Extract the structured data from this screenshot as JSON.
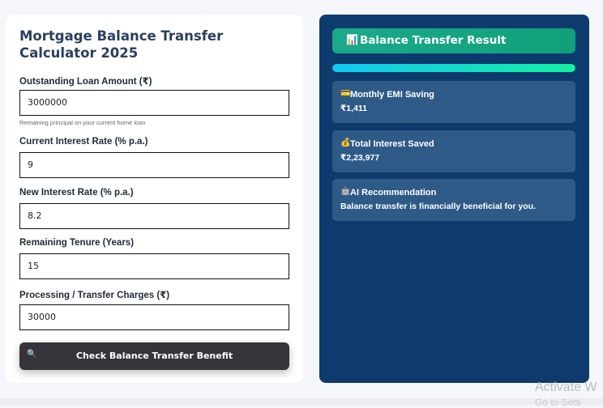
{
  "calculator": {
    "title": "Mortgage Balance Transfer Calculator 2025",
    "fields": [
      {
        "label": "Outstanding Loan Amount (₹)",
        "value": "3000000",
        "hint": "Remaining principal on your current home loan"
      },
      {
        "label": "Current Interest Rate (% p.a.)",
        "value": "9"
      },
      {
        "label": "New Interest Rate (% p.a.)",
        "value": "8.2"
      },
      {
        "label": "Remaining Tenure (Years)",
        "value": "15"
      },
      {
        "label": "Processing / Transfer Charges (₹)",
        "value": "30000"
      }
    ],
    "button": {
      "label": "Check Balance Transfer Benefit",
      "icon": "🔍"
    }
  },
  "result": {
    "title": "Balance Transfer Result",
    "title_icon": "📊",
    "progress": 1.0,
    "cards": [
      {
        "icon": "💳",
        "title": "Monthly EMI Saving",
        "value": "₹1,411"
      },
      {
        "icon": "💰",
        "title": "Total Interest Saved",
        "value": "₹2,23,977"
      },
      {
        "icon": "🤖",
        "title": "AI Recommendation",
        "value": "Balance transfer is financially beneficial for you."
      }
    ]
  },
  "watermark": {
    "line1": "Activate W",
    "line2": "Go to Setti"
  },
  "colors": {
    "panel_bg": "#0d3b6e",
    "card_bg": "#2e5a88",
    "accent_green": "#1aa98a",
    "button_bg": "#35343a"
  }
}
